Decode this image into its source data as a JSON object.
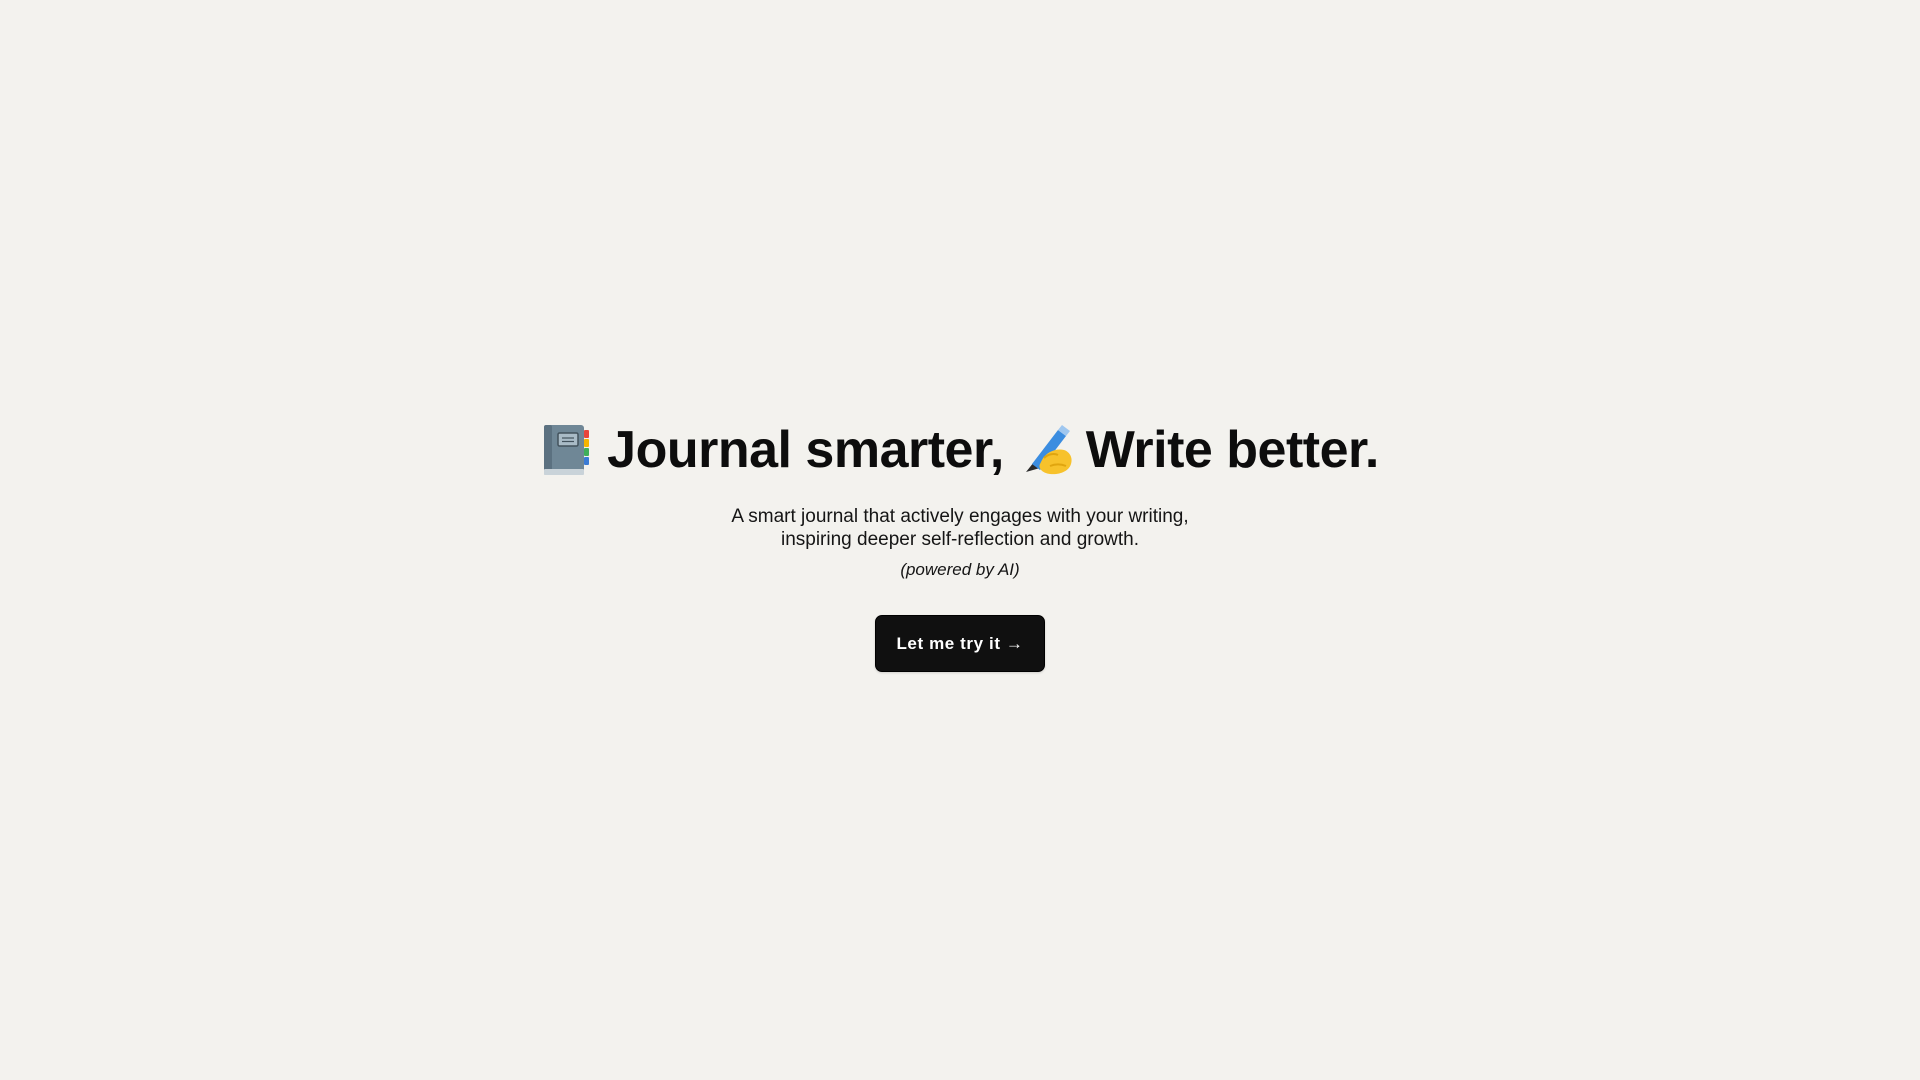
{
  "hero": {
    "notebook_icon": "notebook-with-decorative-cover-icon",
    "headline_part1": "Journal smarter,",
    "writing_icon": "writing-hand-icon",
    "headline_part2": "Write better.",
    "subtitle_line1": "A smart journal that actively engages with your writing,",
    "subtitle_line2": "inspiring deeper self-reflection and growth.",
    "powered_by": "(powered by AI)",
    "cta_label": "Let me try it →"
  },
  "colors": {
    "background": "#f3f2ee",
    "text": "#0d0d0d",
    "button_bg": "#101010",
    "button_text": "#ffffff"
  }
}
